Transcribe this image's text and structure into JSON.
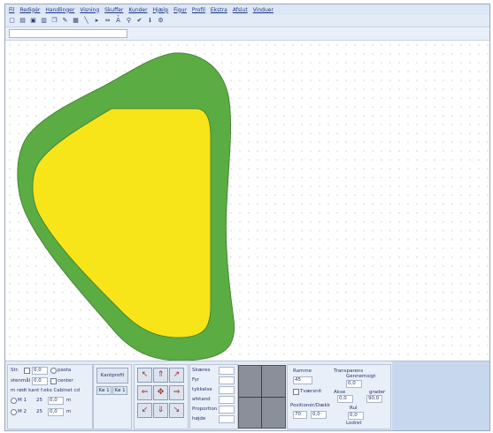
{
  "menu": [
    "Fil",
    "Redigér",
    "Handlinger",
    "Visning",
    "Skuffer",
    "Kunder",
    "Hjælp",
    "Figur",
    "Profil",
    "Ekstra",
    "Afslut",
    "Vinduer"
  ],
  "toolbar_icons": [
    "new-icon",
    "open-icon",
    "save-icon",
    "print-icon",
    "copy-icon",
    "pencil-icon",
    "grid-icon",
    "line-icon",
    "arrow-icon",
    "measure-icon",
    "text-icon",
    "zoom-icon",
    "check-icon",
    "info-icon",
    "settings-icon"
  ],
  "colors": {
    "outer_shape": "#5aac43",
    "inner_shape": "#f7e51a",
    "grid_dot": "#c9c9c9",
    "outline": "#3d7a30"
  },
  "bottom": {
    "size_label": "Str.",
    "size_value": "0,0",
    "radio_paste": "pasta",
    "radius_label": "stenmål",
    "radius_value": "0,0",
    "chk_label": "center",
    "relief_label": "m rødt kant f.eks Cabinet cd",
    "r1_label": "M 1",
    "r1_value": "25",
    "r1_unit": "0,0",
    "r1_mm": "m",
    "r2_label": "M 2",
    "r2_value": "25",
    "r2_unit": "0,0",
    "r2_mm": "m",
    "btn_top": "Kantprofil",
    "btn_left": "Kø 1",
    "btn_right": "Kø 1",
    "tools": [
      "↖",
      "⇑",
      "↗",
      "⇐",
      "✥",
      "⇒",
      "↙",
      "⇓",
      "↘"
    ],
    "props": [
      "Skæres",
      "Fyr",
      "tykkelse",
      "afstand",
      "Proportion",
      "højde"
    ],
    "frame_label": "Ramme",
    "frame_value": "45",
    "trans_label": "Transparens",
    "trans_sub": "Gennemsigt",
    "trans_value": "0,0",
    "axis_label": "Akse",
    "axis_val": "0,0",
    "grad_label": "grader",
    "grad_val": "90,0",
    "chk2_label": "Tværsnit",
    "pos_label": "Positionér/Dækk",
    "pos_val1": "70",
    "pos_val2": "0,0",
    "roll_label": "Rul",
    "roll_val": "0,0",
    "pos_hint": "Lodret"
  }
}
